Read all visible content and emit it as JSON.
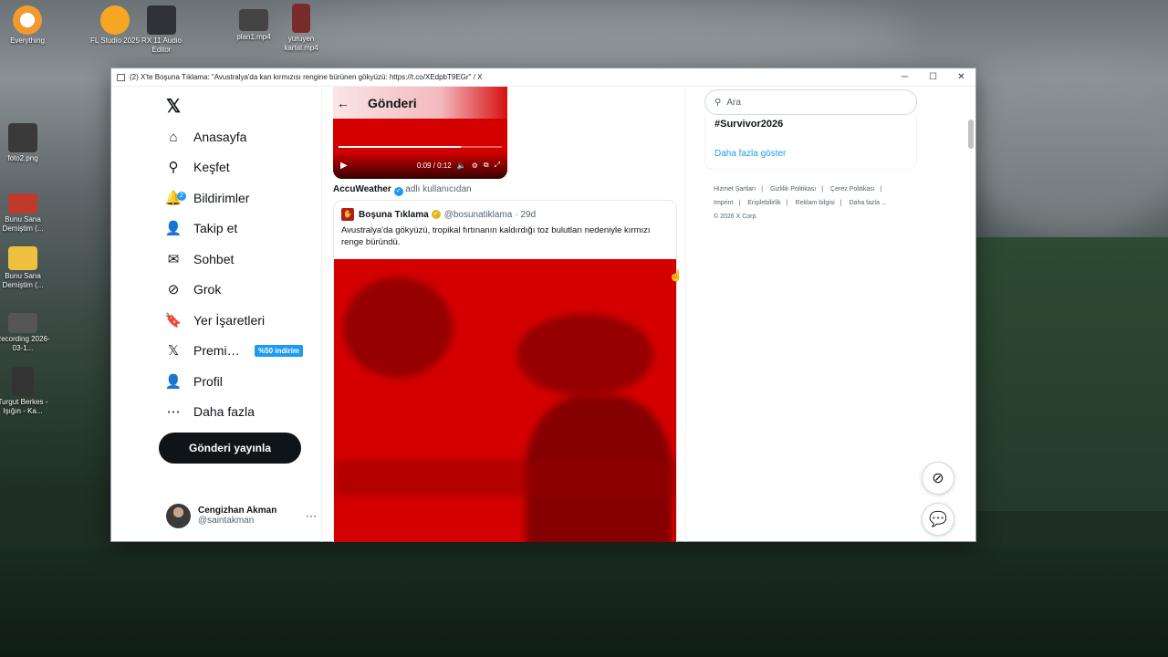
{
  "desktop": {
    "icons": [
      {
        "label": "Everything",
        "color": "#f29a2e"
      },
      {
        "label": "FL Studio 2025",
        "color": "#f6a623"
      },
      {
        "label": "RX 11 Audio Editor",
        "color": "#2f3338"
      },
      {
        "label": "plan1.mp4",
        "color": "#444"
      },
      {
        "label": "yuruyen kartal.mp4",
        "color": "#7a2c2c"
      },
      {
        "label": "foto2.png",
        "color": "#3a3a3a"
      },
      {
        "label": "Bunu Sana Demiştim (...",
        "color": "#c0392b"
      },
      {
        "label": "Bunu Sana Demiştim (...",
        "color": "#f0c040"
      },
      {
        "label": "Recording 2026-03-1...",
        "color": "#555"
      },
      {
        "label": "Turgut Berkes - Işığın - Ka...",
        "color": "#333"
      }
    ]
  },
  "window": {
    "title": "(2) X'te Boşuna Tıklama: \"Avustralya'da kan kırmızısı rengine bürünen gökyüzü: https://t.co/XEdpbT9EGr\" / X",
    "minimize": "─",
    "maximize": "☐",
    "close": "✕"
  },
  "nav": {
    "logo": "𝕏",
    "items": [
      {
        "label": "Anasayfa",
        "icon": "home-icon",
        "glyph": "⌂"
      },
      {
        "label": "Keşfet",
        "icon": "search-icon",
        "glyph": "⚲"
      },
      {
        "label": "Bildirimler",
        "icon": "bell-icon",
        "glyph": "🔔",
        "badge": "2"
      },
      {
        "label": "Takip et",
        "icon": "follow-icon",
        "glyph": "👤"
      },
      {
        "label": "Sohbet",
        "icon": "mail-icon",
        "glyph": "✉"
      },
      {
        "label": "Grok",
        "icon": "grok-icon",
        "glyph": "⊘"
      },
      {
        "label": "Yer İşaretleri",
        "icon": "bookmark-icon",
        "glyph": "🔖"
      },
      {
        "label": "Premium",
        "icon": "x-premium-icon",
        "glyph": "𝕏",
        "promo": "%50 indirim"
      },
      {
        "label": "Profil",
        "icon": "profile-icon",
        "glyph": "👤"
      },
      {
        "label": "Daha fazla",
        "icon": "more-icon",
        "glyph": "⋯"
      }
    ],
    "post_button": "Gönderi yayınla",
    "account": {
      "name": "Cengizhan Akman",
      "handle": "@saintakman",
      "more": "···"
    }
  },
  "main": {
    "back": "←",
    "title": "Gönderi",
    "video": {
      "time": "0:09 / 0:12",
      "progress": 0.75,
      "color": "#d40000"
    },
    "attribution": {
      "name": "AccuWeather",
      "suffix": "adlı kullanıcıdan"
    },
    "quote": {
      "name": "Boşuna Tıklama",
      "handle": "@bosunatiklama",
      "age": "· 29d",
      "text": "Avustralya'da gökyüzü, tropikal fırtınanın kaldırdığı toz bulutları nedeniyle kırmızı renge büründü."
    }
  },
  "right": {
    "search_placeholder": "Ara",
    "trend": "#Survivor2026",
    "show_more": "Daha fazla göster",
    "footer": [
      "Hizmet Şartları",
      "|",
      "Gizlilik Politikası",
      "|",
      "Çerez Politikası",
      "|",
      "Imprint",
      "|",
      "Erişilebilirlik",
      "|",
      "Reklam bilgisi",
      "|",
      "Daha fazla ...",
      "© 2026 X Corp."
    ]
  }
}
